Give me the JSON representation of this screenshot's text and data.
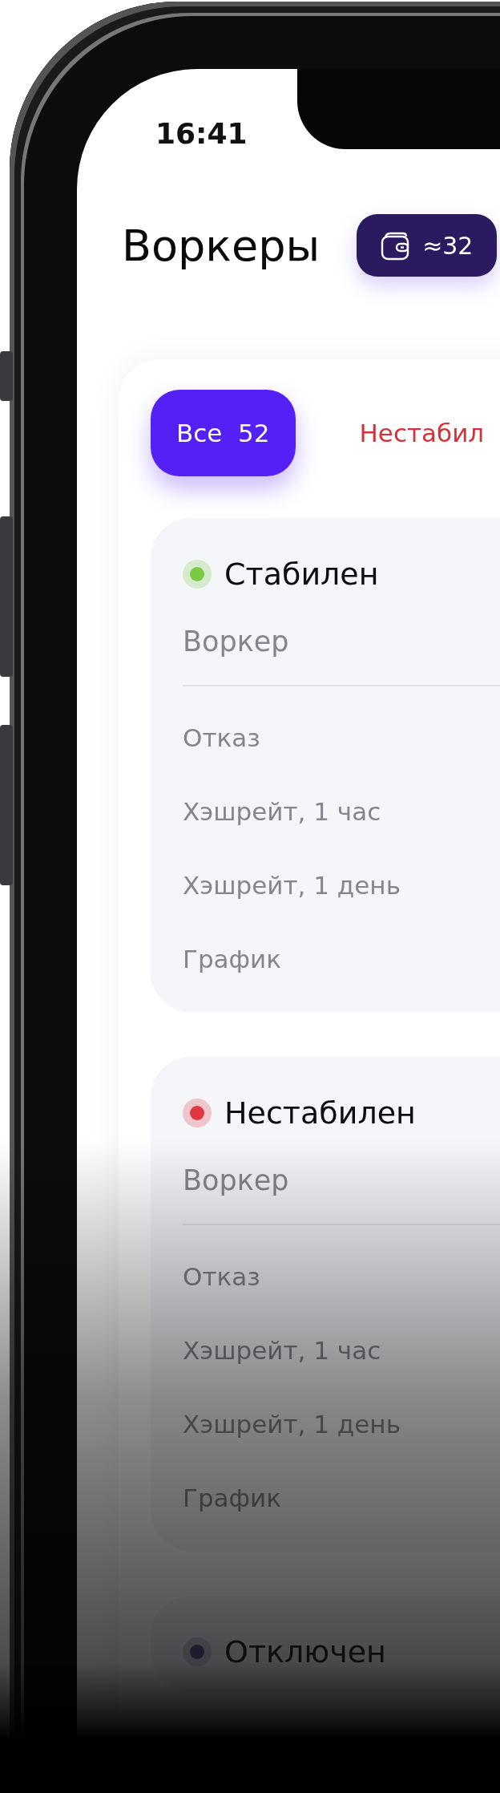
{
  "status_bar": {
    "time": "16:41"
  },
  "header": {
    "title": "Воркеры",
    "balance": "≈32"
  },
  "tabs": [
    {
      "label": "Все",
      "count": "52",
      "selected": true,
      "kind": "all"
    },
    {
      "label": "Нестабил",
      "selected": false,
      "kind": "unstable"
    }
  ],
  "workers": [
    {
      "status": "Стабилен",
      "color": "#7ac943",
      "title": "Воркер",
      "rows": [
        "Отказ",
        "Хэшрейт, 1 час",
        "Хэшрейт, 1 день",
        "График"
      ]
    },
    {
      "status": "Нестабилен",
      "color": "#e0383e",
      "title": "Воркер",
      "rows": [
        "Отказ",
        "Хэшрейт, 1 час",
        "Хэшрейт, 1 день",
        "График"
      ]
    },
    {
      "status": "Отключен",
      "color": "#1e1b2e"
    }
  ]
}
